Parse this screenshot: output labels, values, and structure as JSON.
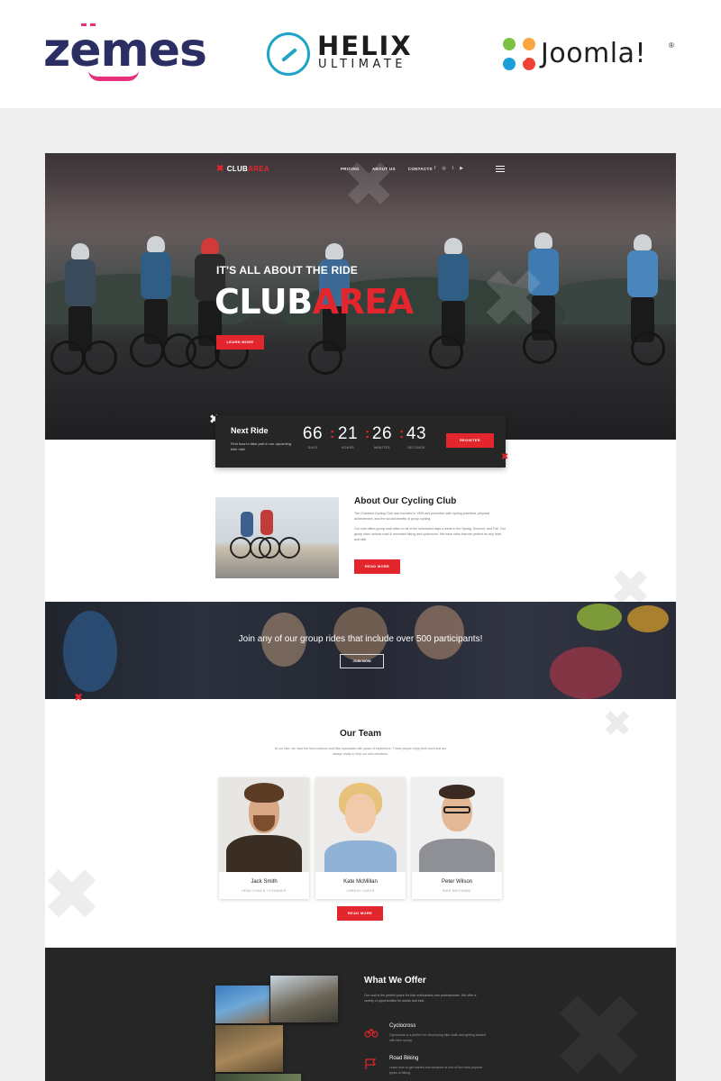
{
  "brands": {
    "zemes": "zemes",
    "helix_title": "HELIX",
    "helix_sub": "ULTIMATE",
    "joomla": "Joomla!",
    "joomla_reg": "®"
  },
  "site": {
    "logo_main": "CLUB",
    "logo_accent": "AREA",
    "nav": [
      "PRICING",
      "ABOUT US",
      "CONTACTS"
    ],
    "social_icons": [
      "facebook-icon",
      "instagram-icon",
      "twitter-icon",
      "youtube-icon"
    ]
  },
  "hero": {
    "tagline": "IT'S ALL ABOUT THE RIDE",
    "title_main": "CLUB",
    "title_accent": "AREA",
    "button": "LEARN MORE"
  },
  "countdown": {
    "title": "Next Ride",
    "subtitle": "Find how to take part in our upcoming bike ride!",
    "days": "66",
    "hours": "21",
    "minutes": "26",
    "seconds": "43",
    "labels": [
      "DAYS",
      "HOURS",
      "MINUTES",
      "SECONDS"
    ],
    "button": "REGISTER"
  },
  "about": {
    "title": "About Our Cycling Club",
    "p1": "The Clubarea Cycling Club was founded in 1995 and promotes safe cycling practices, physical achievement, and the social benefits of group cycling.",
    "p2": "Our club offers group road rides on all of the scheduled days a week in the Spring, Summer, and Fall. Our group rides include road & mountain biking and cyclocross. We have rides that are perfect for any level and skill.",
    "button": "READ MORE"
  },
  "band": {
    "text": "Join any of our group rides that include over 500 participants!",
    "button": "JOIN NOW"
  },
  "team": {
    "title": "Our Team",
    "intro": "At our club, we have the best coaches and bike specialists with years of experience. These people enjoy their work and are always ready to help our club members.",
    "members": [
      {
        "name": "Jack Smith",
        "role": "HEAD COACH / FOUNDER"
      },
      {
        "name": "Kate McMillan",
        "role": "CARDIO COACH"
      },
      {
        "name": "Peter Wilson",
        "role": "BIKE MECHANIC"
      }
    ],
    "button": "READ MORE"
  },
  "offer": {
    "title": "What We Offer",
    "intro": "Our club is the perfect place for bike enthusiasts and professionals. We offer a variety of opportunities for adults and kids.",
    "items": [
      {
        "title": "Cyclocross",
        "text": "Cyclocross is a perfect for developing bike skills and getting started with bike racing.",
        "icon": "bicycle-icon"
      },
      {
        "title": "Road Biking",
        "text": "Learn how to get started and advance at one of the most popular types of biking.",
        "icon": "flag-icon"
      }
    ]
  },
  "colors": {
    "accent": "#e3262d",
    "dark": "#262626",
    "zemes_navy": "#2b2e63",
    "zemes_pink": "#e5317b",
    "helix_blue": "#1fa4c6"
  }
}
